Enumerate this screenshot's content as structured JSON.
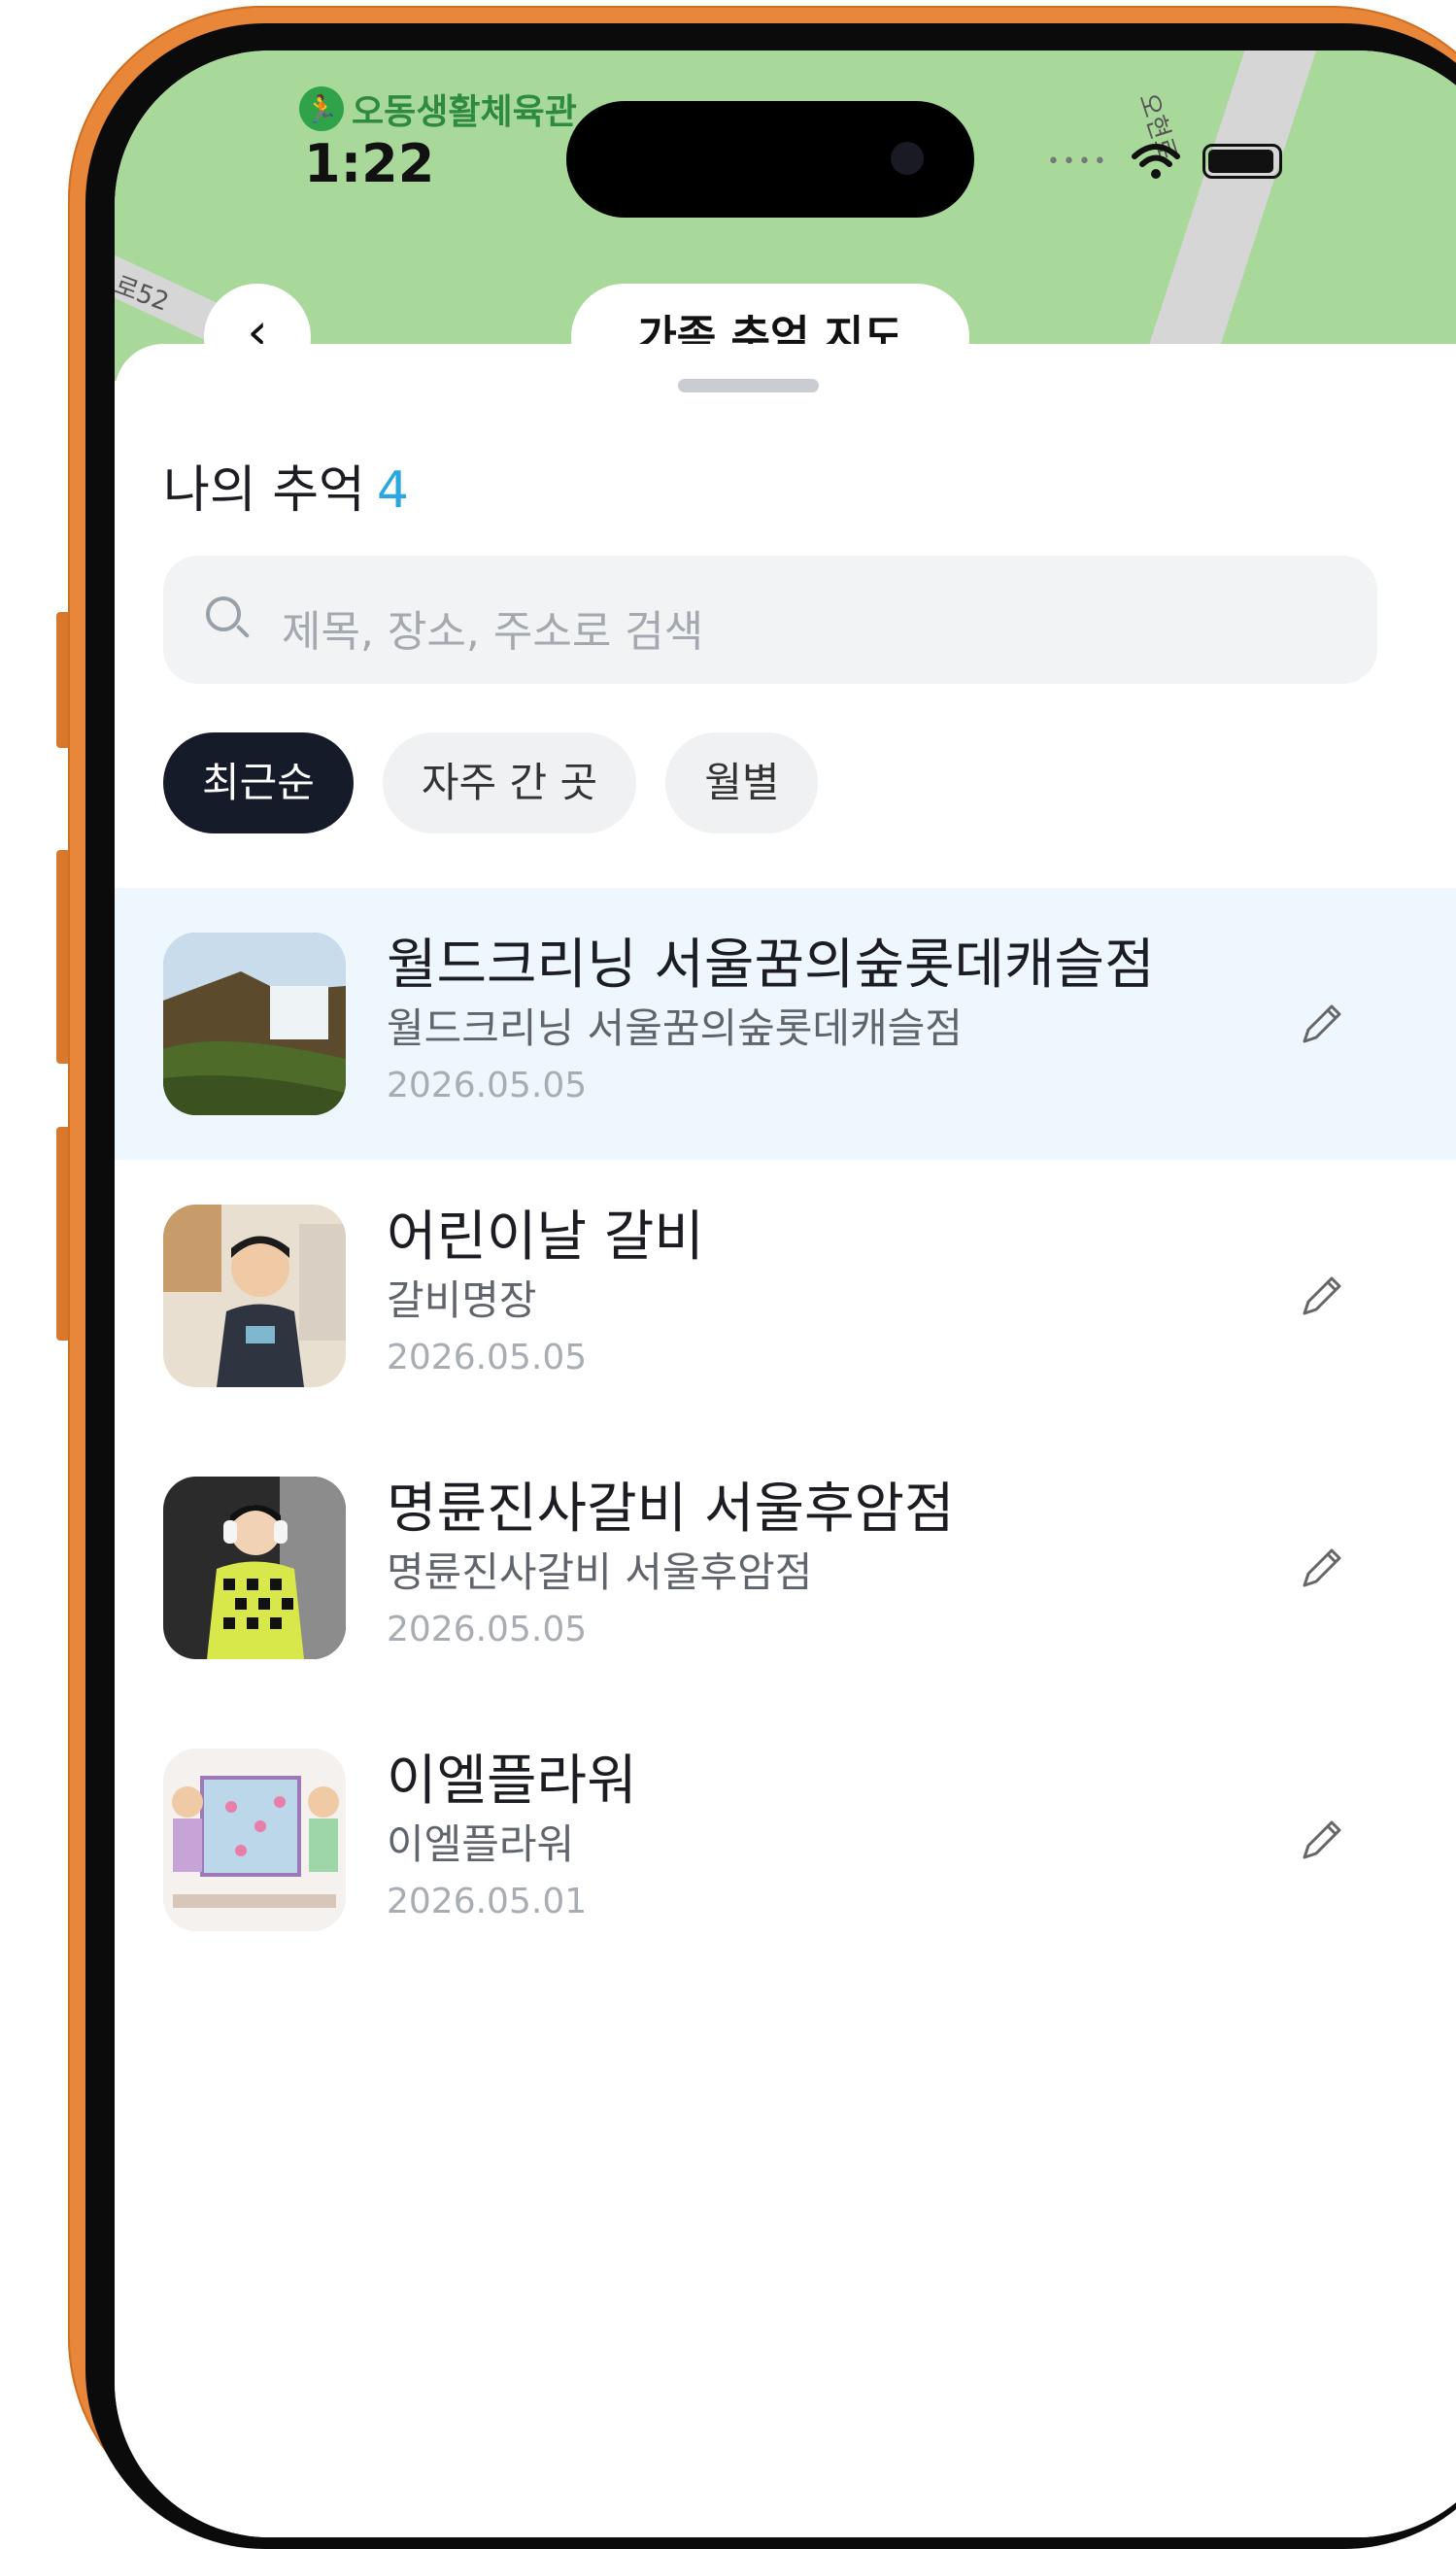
{
  "status_bar": {
    "time": "1:22"
  },
  "map": {
    "poi_label": "오동생활체육관",
    "road_label_1": "오현로",
    "road_label_2": "로52",
    "title": "가족 추억 지도"
  },
  "sheet": {
    "heading": "나의 추억",
    "count": "4",
    "search_placeholder": "제목, 장소, 주소로 검색",
    "chips": [
      {
        "label": "최근순",
        "active": true
      },
      {
        "label": "자주 간 곳",
        "active": false
      },
      {
        "label": "월별",
        "active": false
      }
    ]
  },
  "memories": [
    {
      "title": "월드크리닝 서울꿈의숲롯데캐슬점",
      "place": "월드크리닝 서울꿈의숲롯데캐슬점",
      "date": "2026.05.05",
      "thumb": "waterfall-photo"
    },
    {
      "title": "어린이날 갈비",
      "place": "갈비명장",
      "date": "2026.05.05",
      "thumb": "child-photo"
    },
    {
      "title": "명륜진사갈비 서울후암점",
      "place": "명륜진사갈비 서울후암점",
      "date": "2026.05.05",
      "thumb": "child-jacket-photo"
    },
    {
      "title": "이엘플라워",
      "place": "이엘플라워",
      "date": "2026.05.01",
      "thumb": "drawing-photo"
    }
  ],
  "icons": {
    "back": "chevron-left-icon",
    "search": "search-icon",
    "edit": "pencil-icon",
    "wifi": "wifi-icon",
    "battery": "battery-icon"
  },
  "colors": {
    "accent": "#2aa6e0",
    "chip_active": "#151b28",
    "highlight_row": "#eef7fd",
    "device_frame": "#e8873a"
  }
}
